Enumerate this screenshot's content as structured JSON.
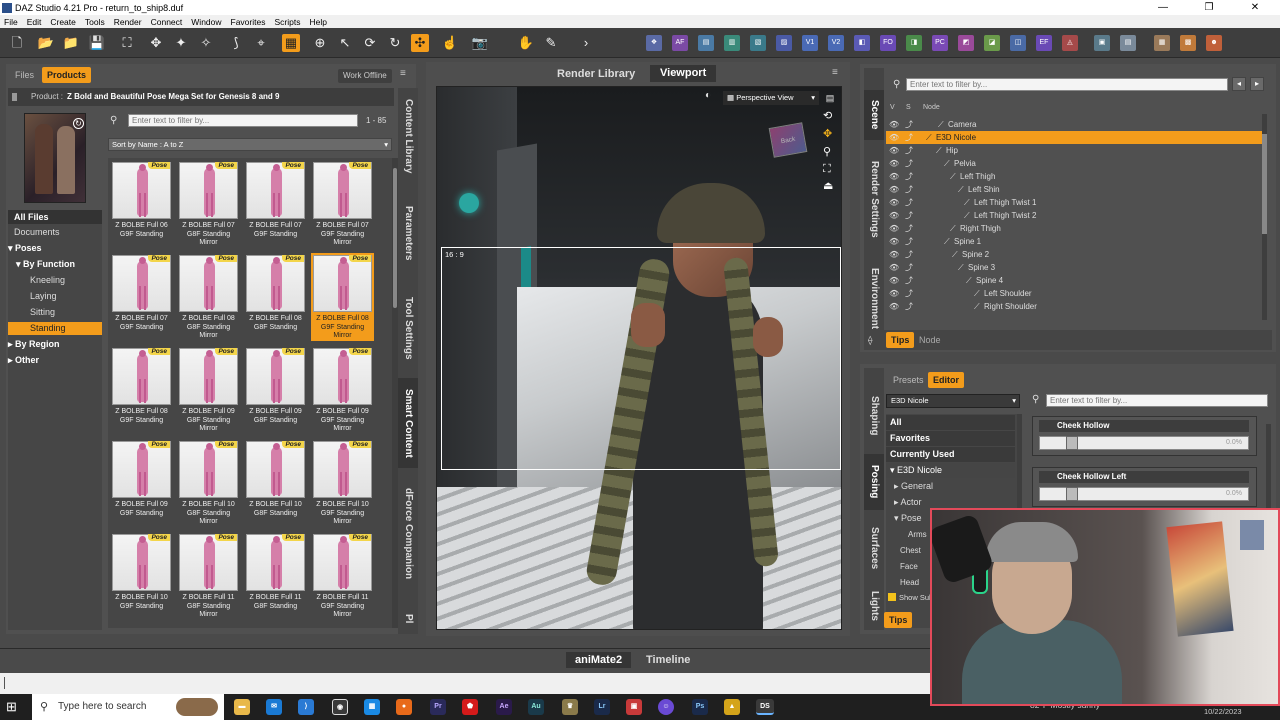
{
  "window": {
    "title": "DAZ Studio 4.21 Pro - return_to_ship8.duf"
  },
  "menu": [
    "File",
    "Edit",
    "Create",
    "Tools",
    "Render",
    "Connect",
    "Window",
    "Favorites",
    "Scripts",
    "Help"
  ],
  "plugin_icons": [
    "AF",
    "V1",
    "V2",
    "FO",
    "PC",
    "EF"
  ],
  "content_library": {
    "tabs": {
      "files": "Files",
      "products": "Products",
      "work_offline": "Work Offline"
    },
    "product_prefix": "Product :",
    "product_name": "Z Bold and Beautiful Pose Mega Set for Genesis 8 and 9",
    "filter_placeholder": "Enter text to filter by...",
    "range": "1 - 85",
    "sort": "Sort by Name : A to Z",
    "tree": [
      {
        "label": "All Files"
      },
      {
        "label": "Documents"
      },
      {
        "label": "Poses"
      },
      {
        "label": "By Function"
      },
      {
        "label": "Kneeling"
      },
      {
        "label": "Laying"
      },
      {
        "label": "Sitting"
      },
      {
        "label": "Standing"
      },
      {
        "label": "By Region"
      },
      {
        "label": "Other"
      }
    ],
    "badge": "Pose",
    "items": [
      "Z BOLBE Full 06 G9F Standing",
      "Z BOLBE Full 07 G8F Standing Mirror",
      "Z BOLBE Full 07 G9F Standing",
      "Z BOLBE Full 07 G9F Standing Mirror",
      "Z BOLBE Full 07 G9F Standing",
      "Z BOLBE Full 08 G8F Standing Mirror",
      "Z BOLBE Full 08 G8F Standing",
      "Z BOLBE Full 08 G9F Standing Mirror",
      "Z BOLBE Full 08 G9F Standing",
      "Z BOLBE Full 09 G8F Standing Mirror",
      "Z BOLBE Full 09 G8F Standing",
      "Z BOLBE Full 09 G9F Standing Mirror",
      "Z BOLBE Full 09 G9F Standing",
      "Z BOLBE Full 10 G8F Standing Mirror",
      "Z BOLBE Full 10 G8F Standing",
      "Z BOLBE Full 10 G9F Standing Mirror",
      "Z BOLBE Full 10 G9F Standing",
      "Z BOLBE Full 11 G8F Standing Mirror",
      "Z BOLBE Full 11 G8F Standing",
      "Z BOLBE Full 11 G9F Standing Mirror"
    ],
    "side_tabs": [
      "Content Library",
      "Parameters",
      "Tool Settings",
      "Smart Content",
      "dForce Companion",
      "Pl"
    ]
  },
  "viewport": {
    "tabs": {
      "render": "Render Library",
      "viewport": "Viewport"
    },
    "view": "Perspective View",
    "aspect": "16 : 9",
    "cube_label": "Back"
  },
  "scene": {
    "filter_placeholder": "Enter text to filter by...",
    "cols": {
      "v": "V",
      "s": "S",
      "node": "Node"
    },
    "nodes": [
      {
        "label": "Camera",
        "indent": 52
      },
      {
        "label": "E3D Nicole",
        "indent": 40,
        "selected": true
      },
      {
        "label": "Hip",
        "indent": 50
      },
      {
        "label": "Pelvia",
        "indent": 58
      },
      {
        "label": "Left Thigh",
        "indent": 64
      },
      {
        "label": "Left Shin",
        "indent": 72
      },
      {
        "label": "Left Thigh Twist 1",
        "indent": 78
      },
      {
        "label": "Left Thigh Twist 2",
        "indent": 78
      },
      {
        "label": "Right Thigh",
        "indent": 64
      },
      {
        "label": "Spine 1",
        "indent": 58
      },
      {
        "label": "Spine 2",
        "indent": 66
      },
      {
        "label": "Spine 3",
        "indent": 72
      },
      {
        "label": "Spine 4",
        "indent": 80
      },
      {
        "label": "Left Shoulder",
        "indent": 88
      },
      {
        "label": "Right Shoulder",
        "indent": 88
      }
    ],
    "side_tabs": [
      "Scene",
      "Render Settings",
      "Environment"
    ],
    "bottom": {
      "tips": "Tips",
      "node": "Node"
    }
  },
  "shaping": {
    "tabs": {
      "presets": "Presets",
      "editor": "Editor"
    },
    "figure": "E3D Nicole",
    "filter_placeholder": "Enter text to filter by...",
    "cats": [
      "All",
      "Favorites",
      "Currently Used"
    ],
    "tree": [
      "E3D Nicole",
      "General",
      "Actor",
      "Pose",
      "Arms",
      "Chest",
      "Face",
      "Head"
    ],
    "show_sub": "Show Sub",
    "sliders": [
      {
        "label": "Cheek Hollow",
        "value": "0.0%"
      },
      {
        "label": "Cheek Hollow Left",
        "value": "0.0%"
      }
    ],
    "side_tabs": [
      "Shaping",
      "Posing",
      "Surfaces",
      "Lights"
    ],
    "tips": "Tips"
  },
  "bottom_tabs": {
    "animate": "aniMate2",
    "timeline": "Timeline"
  },
  "taskbar": {
    "search": "Type here to search",
    "weather": "82°F  Mostly sunny",
    "date": "10/22/2023"
  },
  "colors": {
    "accent": "#f39c1b",
    "panel": "#505050",
    "dark": "#3b3b3b"
  }
}
